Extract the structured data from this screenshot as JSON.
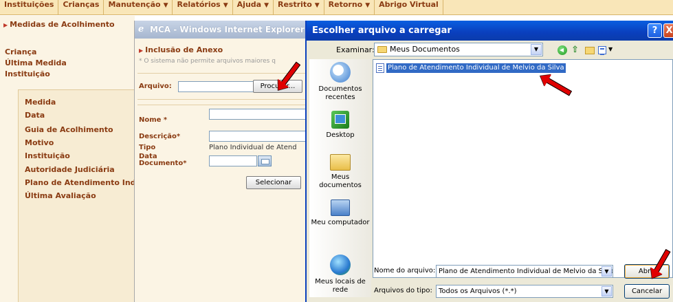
{
  "menu": [
    {
      "label": "Instituições",
      "dropdown": false
    },
    {
      "label": "Crianças",
      "dropdown": false
    },
    {
      "label": "Manutenção",
      "dropdown": true
    },
    {
      "label": "Relatórios",
      "dropdown": true
    },
    {
      "label": "Ajuda",
      "dropdown": true
    },
    {
      "label": "Restrito",
      "dropdown": true
    },
    {
      "label": "Retorno",
      "dropdown": true
    },
    {
      "label": "Abrigo Virtual",
      "dropdown": false
    }
  ],
  "left_panel": {
    "breadcrumb": "Medidas de Acolhimento",
    "fields": [
      "Criança",
      "Última Medida",
      "Instituição"
    ],
    "sub_fields": [
      "Medida",
      "Data",
      "Guia de Acolhimento",
      "Motivo",
      "Instituição",
      "Autoridade Judiciária",
      "Plano de Atendimento Indiv",
      "Última Avaliação"
    ]
  },
  "ie_window": {
    "title": "MCA - Windows Internet Explorer",
    "heading": "Inclusão de Anexo",
    "note": "* O sistema não permite arquivos maiores q",
    "arquivo_label": "Arquivo:",
    "arquivo_value": "",
    "browse_button": "Procurar...",
    "nome_label": "Nome *",
    "descricao_label": "Descrição*",
    "tipo_label": "Tipo",
    "tipo_value": "Plano Individual de Atend",
    "data_label_1": "Data",
    "data_label_2": "Documento*",
    "select_button": "Selecionar"
  },
  "file_dialog": {
    "title": "Escolher arquivo a carregar",
    "help_glyph": "?",
    "close_glyph": "X",
    "lookin_label": "Examinar:",
    "lookin_value": "Meus Documentos",
    "places": [
      {
        "name": "Documentos recentes",
        "icon": "recent-documents-icon"
      },
      {
        "name": "Desktop",
        "icon": "desktop-icon"
      },
      {
        "name": "Meus documentos",
        "icon": "my-documents-icon"
      },
      {
        "name": "Meu computador",
        "icon": "my-computer-icon"
      },
      {
        "name": "Meus locais de rede",
        "icon": "network-places-icon"
      }
    ],
    "files": [
      {
        "name": "Plano de Atendimento Individual de Melvio da Silva",
        "selected": true
      }
    ],
    "filename_label": "Nome do arquivo:",
    "filename_value": "Plano de Atendimento Individual de Melvio da Silva",
    "filetype_label": "Arquivos do tipo:",
    "filetype_value": "Todos os Arquivos (*.*)",
    "open_button": "Abrir",
    "cancel_button": "Cancelar"
  },
  "colors": {
    "menu_bg": "#f9e6b8",
    "brand_text": "#8a3b12",
    "xp_title_blue": "#0a3fbd",
    "selection_blue": "#316ac5",
    "annotation_red": "#e00000"
  }
}
